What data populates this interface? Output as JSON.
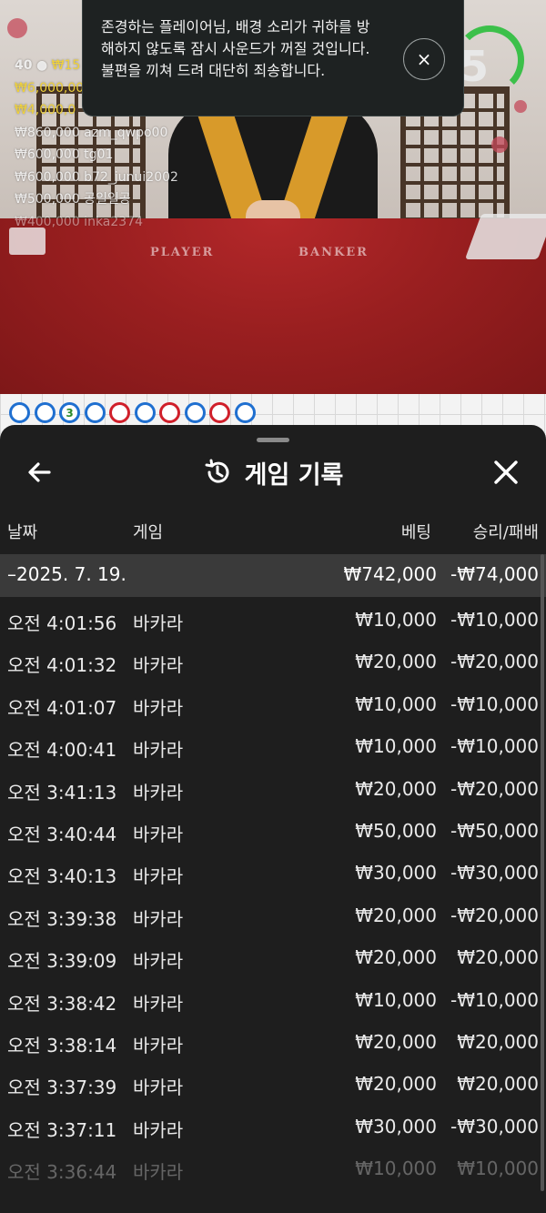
{
  "video": {
    "player_count": "40",
    "timer_value": "5",
    "table_labels": [
      "PLAYER",
      "BANKER"
    ],
    "bets": [
      {
        "text": "₩6,000,000",
        "tone": "gold"
      },
      {
        "text": "₩4,000,0",
        "tone": "gold"
      },
      {
        "text": "₩860,000  azm_qwpo00",
        "tone": "white"
      },
      {
        "text": "₩600,000  tg01",
        "tone": "white"
      },
      {
        "text": "₩600,000  b72_junui2002",
        "tone": "white"
      },
      {
        "text": "₩500,000  공일일공",
        "tone": "white"
      },
      {
        "text": "₩400,000  inka2374",
        "tone": "fade"
      }
    ],
    "header_bet": "₩15"
  },
  "toast": {
    "message": "존경하는 플레이어님, 배경 소리가 귀하를 방해하지 않도록 잠시 사운드가 꺼질 것입니다. 불편을 끼쳐 드려 대단히 죄송합니다.",
    "close_label": "×"
  },
  "road": {
    "beads": [
      "b",
      "b",
      "tie",
      "b",
      "r",
      "b",
      "r",
      "b",
      "r",
      "b"
    ],
    "tie_number": "3"
  },
  "history": {
    "title": "게임 기록",
    "columns": {
      "date": "날짜",
      "game": "게임",
      "bet": "베팅",
      "result": "승리/패배"
    },
    "summary": {
      "date": "–2025. 7. 19.",
      "bet": "₩742,000",
      "result": "-₩74,000"
    },
    "rows": [
      {
        "time": "오전 4:01:56",
        "game": "바카라",
        "bet": "₩10,000",
        "result": "-₩10,000"
      },
      {
        "time": "오전 4:01:32",
        "game": "바카라",
        "bet": "₩20,000",
        "result": "-₩20,000"
      },
      {
        "time": "오전 4:01:07",
        "game": "바카라",
        "bet": "₩10,000",
        "result": "-₩10,000"
      },
      {
        "time": "오전 4:00:41",
        "game": "바카라",
        "bet": "₩10,000",
        "result": "-₩10,000"
      },
      {
        "time": "오전 3:41:13",
        "game": "바카라",
        "bet": "₩20,000",
        "result": "-₩20,000"
      },
      {
        "time": "오전 3:40:44",
        "game": "바카라",
        "bet": "₩50,000",
        "result": "-₩50,000"
      },
      {
        "time": "오전 3:40:13",
        "game": "바카라",
        "bet": "₩30,000",
        "result": "-₩30,000"
      },
      {
        "time": "오전 3:39:38",
        "game": "바카라",
        "bet": "₩20,000",
        "result": "-₩20,000"
      },
      {
        "time": "오전 3:39:09",
        "game": "바카라",
        "bet": "₩20,000",
        "result": "₩20,000"
      },
      {
        "time": "오전 3:38:42",
        "game": "바카라",
        "bet": "₩10,000",
        "result": "-₩10,000"
      },
      {
        "time": "오전 3:38:14",
        "game": "바카라",
        "bet": "₩20,000",
        "result": "₩20,000"
      },
      {
        "time": "오전 3:37:39",
        "game": "바카라",
        "bet": "₩20,000",
        "result": "₩20,000"
      },
      {
        "time": "오전 3:37:11",
        "game": "바카라",
        "bet": "₩30,000",
        "result": "-₩30,000"
      },
      {
        "time": "오전 3:36:44",
        "game": "바카라",
        "bet": "₩10,000",
        "result": "₩10,000"
      }
    ]
  },
  "colors": {
    "accent_timer": "#3cc04a",
    "banker": "#d01f2a",
    "player": "#1f6fd0",
    "sheet_bg": "#1e1e1e",
    "summary_bg": "#3a3a3a"
  }
}
